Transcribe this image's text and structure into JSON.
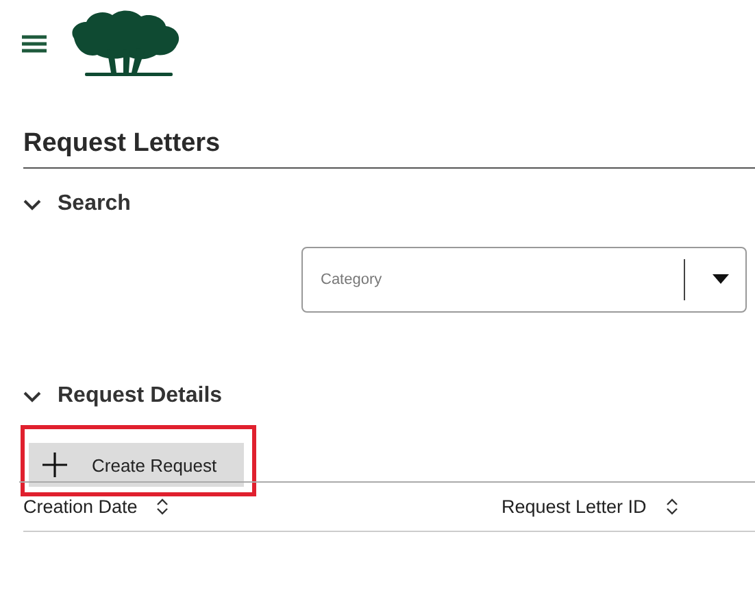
{
  "page": {
    "title": "Request Letters"
  },
  "sections": [
    {
      "title": "Search",
      "expanded": true
    },
    {
      "title": "Request Details",
      "expanded": true
    }
  ],
  "category_field": {
    "placeholder": "Category"
  },
  "create_button": {
    "label": "Create Request",
    "highlighted": true
  },
  "table": {
    "columns": [
      {
        "label": "Creation Date"
      },
      {
        "label": "Request Letter ID"
      }
    ]
  }
}
